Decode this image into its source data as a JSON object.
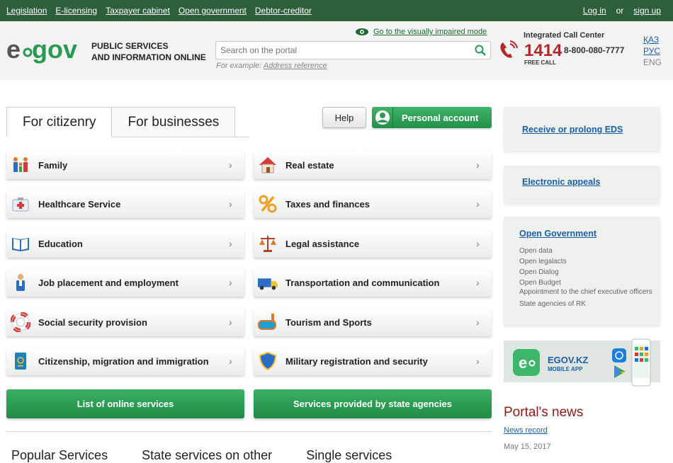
{
  "topbar": {
    "nav": [
      "Legislation",
      "E-licensing",
      "Taxpayer cabinet",
      "Open government",
      "Debtor-creditor"
    ],
    "login": "Log in",
    "or": "or",
    "signup": "sign up"
  },
  "header": {
    "logo_text": "e gov",
    "tagline_line1": "PUBLIC SERVICES",
    "tagline_line2": "AND INFORMATION ONLINE",
    "impaired_link": "Go to the visually impaired mode",
    "search_placeholder": "Search on the portal",
    "example_prefix": "For example:",
    "example_link": "Address reference",
    "call_center_title": "Integrated Call Center",
    "call_number": "1414",
    "call_phone": "8-800-080-7777",
    "free_call": "FREE CALL",
    "languages": [
      "ҚАЗ",
      "РУС",
      "ENG"
    ]
  },
  "tabs": {
    "citizenry": "For citizenry",
    "businesses": "For businesses"
  },
  "buttons": {
    "help": "Help",
    "account": "Personal account"
  },
  "categories": {
    "left": [
      "Family",
      "Healthcare Service",
      "Education",
      "Job placement and employment",
      "Social security provision",
      "Citizenship, migration and immigration"
    ],
    "right": [
      "Real estate",
      "Taxes and finances",
      "Legal assistance",
      "Transportation and communication",
      "Tourism and Sports",
      "Military registration and security"
    ]
  },
  "actions": {
    "list_online": "List of online services",
    "state_agencies": "Services provided by state agencies"
  },
  "bottom_tabs": [
    "Popular Services",
    "State services on other",
    "Single services"
  ],
  "sidebar": {
    "eds": "Receive or prolong EDS",
    "appeals": "Electronic appeals",
    "open_gov_title": "Open Government",
    "open_gov_items": [
      "Open data",
      "Open legalacts",
      "Open Dialog",
      "Open Budget",
      "Appointment to the chief executive officers",
      "State agencies of RK"
    ],
    "app_title": "EGOV.KZ",
    "app_subtitle": "MOBILE APP"
  },
  "news": {
    "title": "Portal's news",
    "record": "News record",
    "date": "May 15, 2017"
  },
  "colors": {
    "topbar": "#2d5f3b",
    "accent_green": "#2a9a52",
    "link_blue": "#1a5fa8",
    "call_red": "#b22828",
    "news_red": "#8b1a1a"
  }
}
